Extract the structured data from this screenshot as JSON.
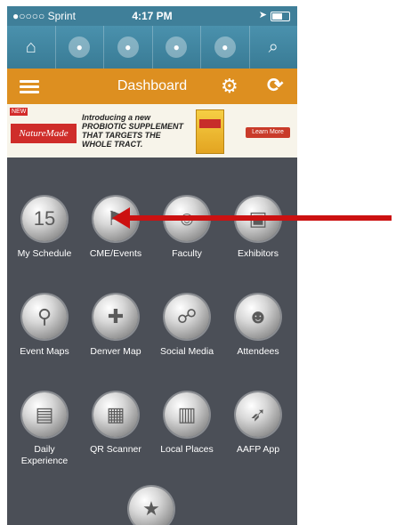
{
  "status_bar": {
    "carrier": "●○○○○ Sprint",
    "time": "4:17 PM"
  },
  "top_nav": {
    "items": [
      {
        "icon": "home-icon",
        "glyph": "⌂"
      },
      {
        "icon": "map-circle-icon",
        "glyph": "●"
      },
      {
        "icon": "bus-circle-icon",
        "glyph": "●"
      },
      {
        "icon": "building-circle-icon",
        "glyph": "●"
      },
      {
        "icon": "globe-circle-icon",
        "glyph": "●"
      },
      {
        "icon": "search-icon",
        "glyph": "⌕"
      }
    ]
  },
  "title_bar": {
    "title": "Dashboard"
  },
  "ad": {
    "badge": "NEW",
    "brand": "NatureMade",
    "line1": "Introducing a new",
    "line2": "PROBIOTIC SUPPLEMENT",
    "line3": "THAT TARGETS THE",
    "line4": "WHOLE TRACT.",
    "cta": "Learn More"
  },
  "tiles": [
    {
      "label": "My Schedule",
      "glyph": "15"
    },
    {
      "label": "CME/Events",
      "glyph": "⚑"
    },
    {
      "label": "Faculty",
      "glyph": "☺"
    },
    {
      "label": "Exhibitors",
      "glyph": "▣"
    },
    {
      "label": "Event Maps",
      "glyph": "⚲"
    },
    {
      "label": "Denver Map",
      "glyph": "✚"
    },
    {
      "label": "Social Media",
      "glyph": "☍"
    },
    {
      "label": "Attendees",
      "glyph": "☻"
    },
    {
      "label": "Daily Experience",
      "glyph": "▤"
    },
    {
      "label": "QR Scanner",
      "glyph": "▦"
    },
    {
      "label": "Local Places",
      "glyph": "▥"
    },
    {
      "label": "AAFP App",
      "glyph": "➶"
    },
    {
      "label": "",
      "glyph": "★"
    }
  ]
}
